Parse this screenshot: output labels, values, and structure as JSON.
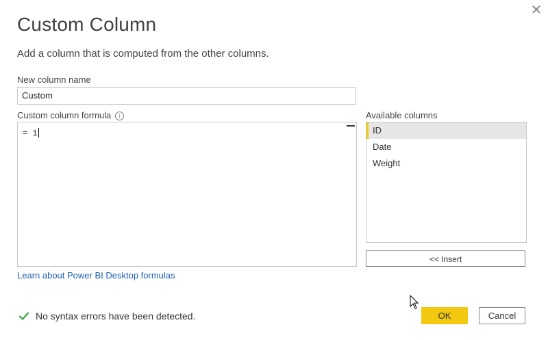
{
  "dialog": {
    "title": "Custom Column",
    "subtitle": "Add a column that is computed from the other columns.",
    "close_icon": "close-icon"
  },
  "name_field": {
    "label": "New column name",
    "value": "Custom"
  },
  "formula": {
    "label": "Custom column formula",
    "info_icon": "info-icon",
    "value": "= 1"
  },
  "available_columns": {
    "label": "Available columns",
    "items": [
      {
        "label": "ID",
        "selected": true
      },
      {
        "label": "Date",
        "selected": false
      },
      {
        "label": "Weight",
        "selected": false
      }
    ],
    "insert_label": "<< Insert"
  },
  "learn_link": "Learn about Power BI Desktop formulas",
  "status": {
    "icon": "checkmark-icon",
    "text": "No syntax errors have been detected.",
    "color": "#3a9d3a"
  },
  "buttons": {
    "ok_label": "OK",
    "cancel_label": "Cancel",
    "accent": "#f2c811"
  }
}
